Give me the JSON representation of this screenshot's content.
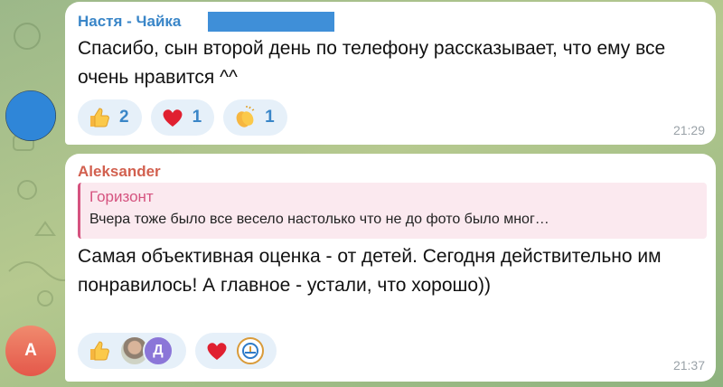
{
  "messages": [
    {
      "sender": "Настя - Чайка",
      "text": "Спасибо, сын второй день по телефону рассказывает, что ему все очень нравится ^^",
      "time": "21:29",
      "reactions": [
        {
          "icon": "thumbs-up-icon",
          "count": "2"
        },
        {
          "icon": "red-heart-icon",
          "count": "1"
        },
        {
          "icon": "clapping-hands-icon",
          "count": "1"
        }
      ],
      "avatar_icon": "user-photo-avatar"
    },
    {
      "sender": "Aleksander",
      "avatar_letter": "A",
      "reply": {
        "name": "Горизонт",
        "text": "Вчера тоже было все весело настолько что не до фото было мног…"
      },
      "text": "Самая объективная оценка - от детей. Сегодня действительно им понравилось! А главное - устали, что хорошо))",
      "time": "21:37",
      "reactions": [
        {
          "icon": "thumbs-up-icon",
          "reactor_letter": "Д"
        },
        {
          "icon": "red-heart-icon",
          "reactor_icon": "gorizont-logo-icon"
        }
      ]
    }
  ],
  "colors": {
    "sender1": "#3a86c8",
    "sender2": "#d2604f",
    "reply_accent": "#d5537f",
    "reaction_bg": "#e6f0f9",
    "background": "#9cb889"
  }
}
